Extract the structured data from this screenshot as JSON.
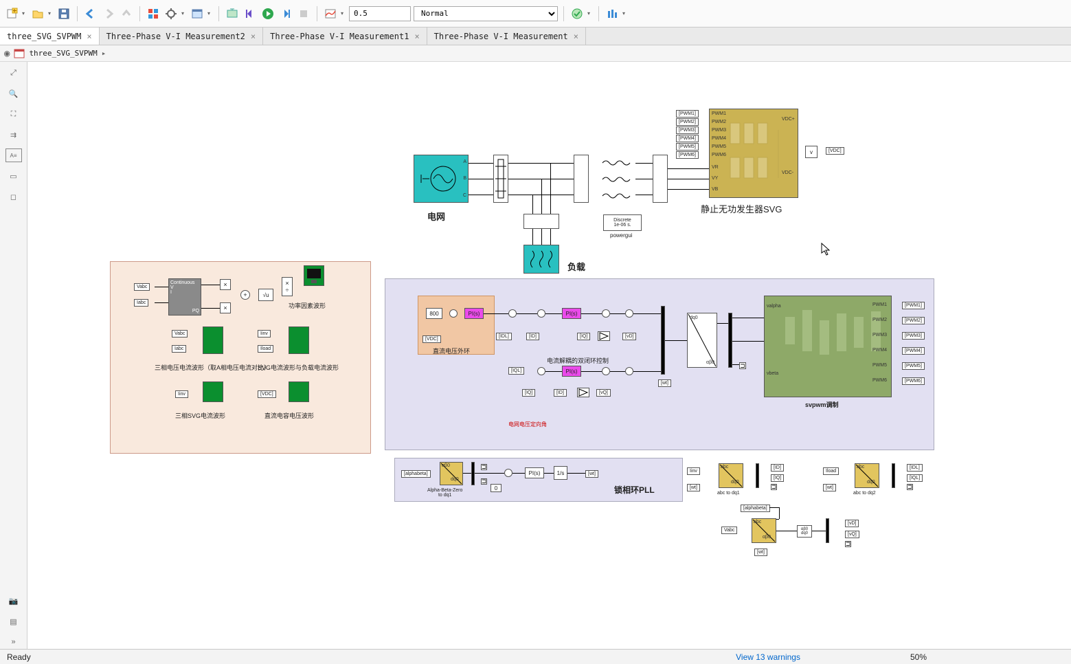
{
  "toolbar": {
    "sim_time": "0.5",
    "mode": "Normal"
  },
  "tabs": [
    {
      "label": "three_SVG_SVPWM",
      "active": true
    },
    {
      "label": "Three-Phase V-I Measurement2",
      "active": false
    },
    {
      "label": "Three-Phase V-I Measurement1",
      "active": false
    },
    {
      "label": "Three-Phase V-I Measurement",
      "active": false
    }
  ],
  "breadcrumb": {
    "model": "three_SVG_SVPWM"
  },
  "status": {
    "ready": "Ready",
    "warnings": "View 13 warnings",
    "zoom": "50%"
  },
  "model": {
    "grid_label": "电网",
    "load_label": "负载",
    "svg_label": "静止无功发生器SVG",
    "powergui_label": "powergui",
    "powergui_top": "Discrete",
    "powergui_bottom": "1e-06 s.",
    "panel1": {
      "constant": "Continuous",
      "scope1_label": "功率因素波形",
      "scope2_label": "三相电压电流波形（取A相电压电流对比）",
      "scope3_label": "SVG电流波形与负载电流波形",
      "scope4_label": "三相SVG电流波形",
      "scope5_label": "直流电容电压波形",
      "from_vabc": "Vabc",
      "from_iabc": "Iabc",
      "from_vabc2": "Vabc",
      "from_iabc2": "Iabc",
      "from_iinv": "Iinv",
      "from_iload": "Iload",
      "from_iinv2": "Iinv",
      "from_vdc": "[VDC]"
    },
    "panel2": {
      "dcv_label": "直流电压外环",
      "const800": "800",
      "vdc": "[VDC]",
      "pi1": "PI(s)",
      "idl": "[IDL]",
      "id": "[ID]",
      "pi2": "PI(s)",
      "iq2": "[IQ]",
      "vd": "[vD]",
      "iql": "[IQL]",
      "pi3": "PI(s)",
      "iq3": "[IQ]",
      "id3": "[ID]",
      "vq": "[vQ]",
      "wt": "[wt]",
      "inner_label": "电流解耦的双闭环控制",
      "svpwm_label": "svpwm调制",
      "note": "电网电压定向角",
      "dq0_top": "dq0",
      "dq0_bot": "αβ0",
      "pwm1": "[PWM1]",
      "pwm2": "[PWM2]",
      "pwm3": "[PWM3]",
      "pwm4": "[PWM4]",
      "pwm5": "[PWM5]",
      "pwm6": "[PWM6]",
      "sv_in1": "valpha",
      "sv_in2": "vbeta"
    },
    "panel3": {
      "pll_label": "锁相环PLL",
      "alphabeta": "[alphabeta]",
      "abz_top": "αβ0",
      "abz_bot": "dq0",
      "abz_label": "Alpha-Beta-Zero\nto dq1",
      "pi": "PI(s)",
      "const0": "0",
      "wt_out": "[wt]"
    },
    "svg_block": {
      "pwm1_in": "[PWM1]",
      "pwm2_in": "[PWM2]",
      "pwm3_in": "[PWM3]",
      "pwm4_in": "[PWM4]",
      "pwm5_in": "[PWM5]",
      "pwm6_in": "[PWM6]",
      "p1": "PWM1",
      "p2": "PWM2",
      "p3": "PWM3",
      "p4": "PWM4",
      "p5": "PWM5",
      "p6": "PWM6",
      "vr": "VR",
      "vy": "VY",
      "vb": "VB",
      "vdcp": "VDC+",
      "vdcm": "VDC-",
      "vdc_out": "[VDC]"
    },
    "transforms": {
      "iinv": "Iinv",
      "wt1": "[wt]",
      "abc1_top": "abc",
      "abc1_bot": "dq0",
      "abc1_label": "abc to dq1",
      "id_out": "[ID]",
      "iq_out": "[IQ]",
      "iload": "Iload",
      "wt2": "[wt]",
      "abc2_top": "abc",
      "abc2_bot": "dq0",
      "abc2_label": "abc to dq2",
      "idl_out": "[IDL]",
      "iql_out": "[IQL]",
      "alphabeta_goto": "[alphabeta]",
      "vabc": "Vabc",
      "wt3": "[wt]",
      "abc3_top": "abc",
      "abc3_bot": "αβ0",
      "dq0_small_top": "αβ0",
      "dq0_small_bot": "dq0",
      "vd_out": "[vD]",
      "vq_out": "[vQ]"
    }
  }
}
